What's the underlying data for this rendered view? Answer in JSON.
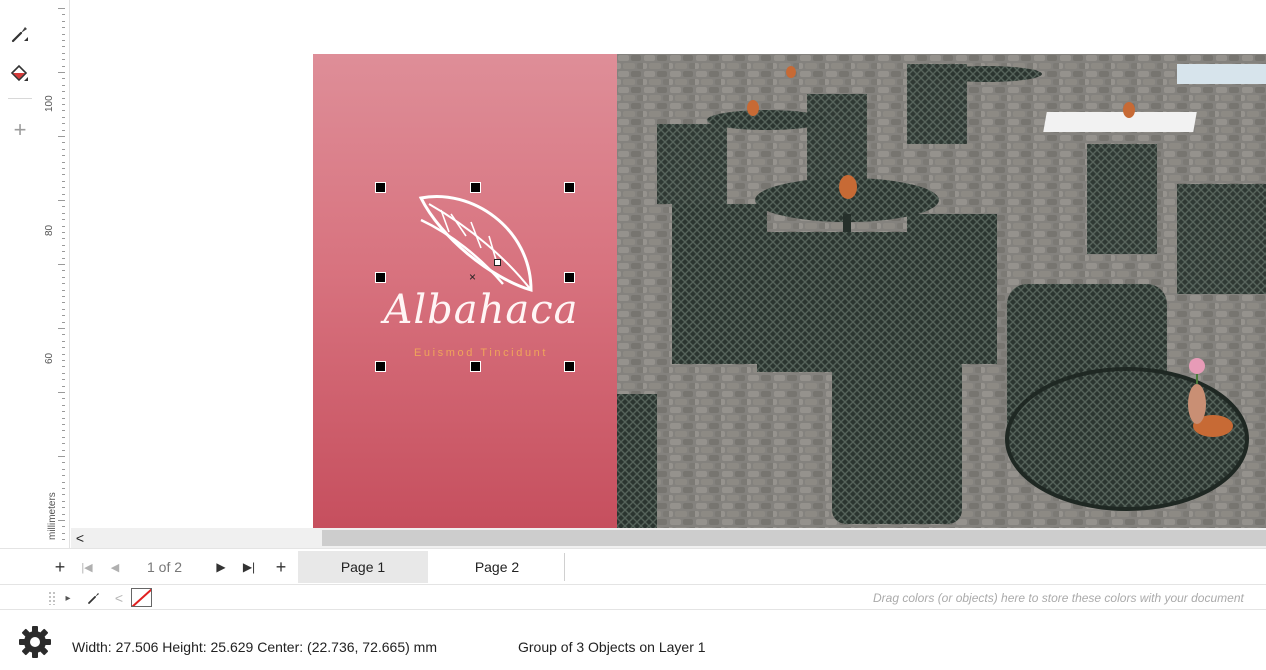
{
  "toolbox": {
    "tools": [
      {
        "icon": "eyedropper-icon"
      },
      {
        "icon": "paint-bucket-icon"
      },
      {
        "icon": "add-tool-icon",
        "glyph": "+"
      }
    ]
  },
  "ruler": {
    "labels": [
      "100",
      "80",
      "60"
    ],
    "unit": "millimeters"
  },
  "canvas": {
    "brand_name": "Albahaca",
    "tagline": "Euismod Tincidunt",
    "colors": {
      "pink_top": "#de8e98",
      "pink_bottom": "#c64f5e",
      "tagline": "#f0a45a"
    }
  },
  "scrollbar": {
    "left_arrow": "<"
  },
  "page_nav": {
    "add_before": "+",
    "first": "|◀",
    "prev": "◀",
    "count": "1 of 2",
    "next": "▶",
    "last": "▶|",
    "add_after": "+",
    "tabs": [
      "Page 1",
      "Page 2"
    ],
    "active_tab": "Page 1"
  },
  "palette": {
    "arrow_right": "▸",
    "arrow_left": "<",
    "drop_hint": "Drag colors (or objects) here to store these colors with your document"
  },
  "status": {
    "dimensions": "Width: 27.506  Height: 25.629  Center: (22.736, 72.665)  mm",
    "selection": "Group of 3 Objects on Layer 1"
  }
}
